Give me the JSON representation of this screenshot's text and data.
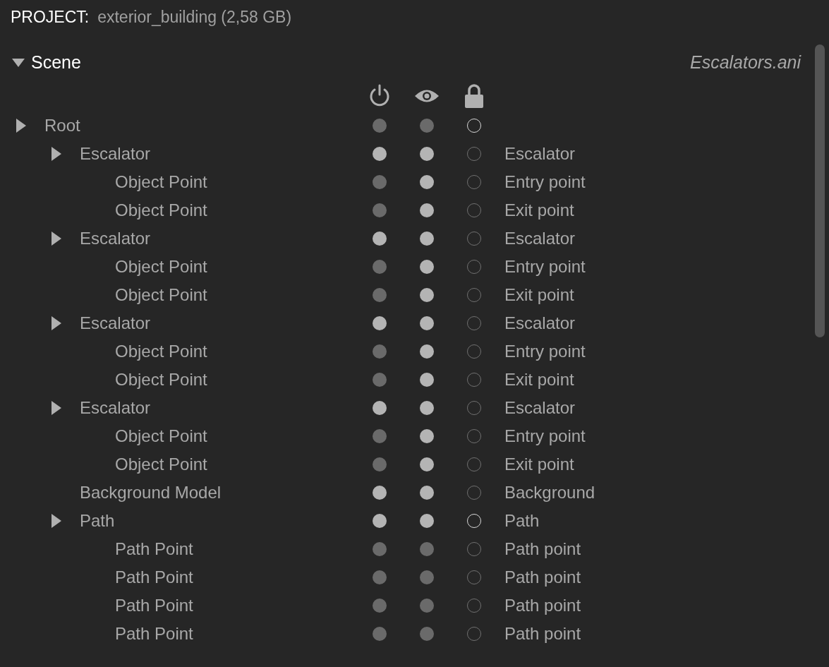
{
  "project": {
    "label": "PROJECT:",
    "value": "exterior_building (2,58 GB)"
  },
  "scene": {
    "title": "Scene",
    "expanded": true,
    "file": "Escalators.ani"
  },
  "tree": [
    {
      "name": "Root",
      "enabled": false,
      "visible": false,
      "lock_emphasized": true,
      "children": [
        {
          "name": "Escalator",
          "enabled": true,
          "visible": true,
          "lock_emphasized": false,
          "label": "Escalator",
          "children": [
            {
              "name": "Object Point",
              "enabled": false,
              "visible": true,
              "lock_emphasized": false,
              "label": "Entry point"
            },
            {
              "name": "Object Point",
              "enabled": false,
              "visible": true,
              "lock_emphasized": false,
              "label": "Exit point"
            }
          ]
        },
        {
          "name": "Escalator",
          "enabled": true,
          "visible": true,
          "lock_emphasized": false,
          "label": "Escalator",
          "children": [
            {
              "name": "Object Point",
              "enabled": false,
              "visible": true,
              "lock_emphasized": false,
              "label": "Entry point"
            },
            {
              "name": "Object Point",
              "enabled": false,
              "visible": true,
              "lock_emphasized": false,
              "label": "Exit point"
            }
          ]
        },
        {
          "name": "Escalator",
          "enabled": true,
          "visible": true,
          "lock_emphasized": false,
          "label": "Escalator",
          "children": [
            {
              "name": "Object Point",
              "enabled": false,
              "visible": true,
              "lock_emphasized": false,
              "label": "Entry point"
            },
            {
              "name": "Object Point",
              "enabled": false,
              "visible": true,
              "lock_emphasized": false,
              "label": "Exit point"
            }
          ]
        },
        {
          "name": "Escalator",
          "enabled": true,
          "visible": true,
          "lock_emphasized": false,
          "label": "Escalator",
          "children": [
            {
              "name": "Object Point",
              "enabled": false,
              "visible": true,
              "lock_emphasized": false,
              "label": "Entry point"
            },
            {
              "name": "Object Point",
              "enabled": false,
              "visible": true,
              "lock_emphasized": false,
              "label": "Exit point"
            }
          ]
        },
        {
          "name": "Background Model",
          "enabled": true,
          "visible": true,
          "lock_emphasized": false,
          "label": "Background"
        },
        {
          "name": "Path",
          "enabled": true,
          "visible": true,
          "lock_emphasized": true,
          "label": "Path",
          "children": [
            {
              "name": "Path Point",
              "enabled": false,
              "visible": false,
              "lock_emphasized": false,
              "label": "Path point"
            },
            {
              "name": "Path Point",
              "enabled": false,
              "visible": false,
              "lock_emphasized": false,
              "label": "Path point"
            },
            {
              "name": "Path Point",
              "enabled": false,
              "visible": false,
              "lock_emphasized": false,
              "label": "Path point"
            },
            {
              "name": "Path Point",
              "enabled": false,
              "visible": false,
              "lock_emphasized": false,
              "label": "Path point"
            }
          ]
        }
      ]
    }
  ]
}
